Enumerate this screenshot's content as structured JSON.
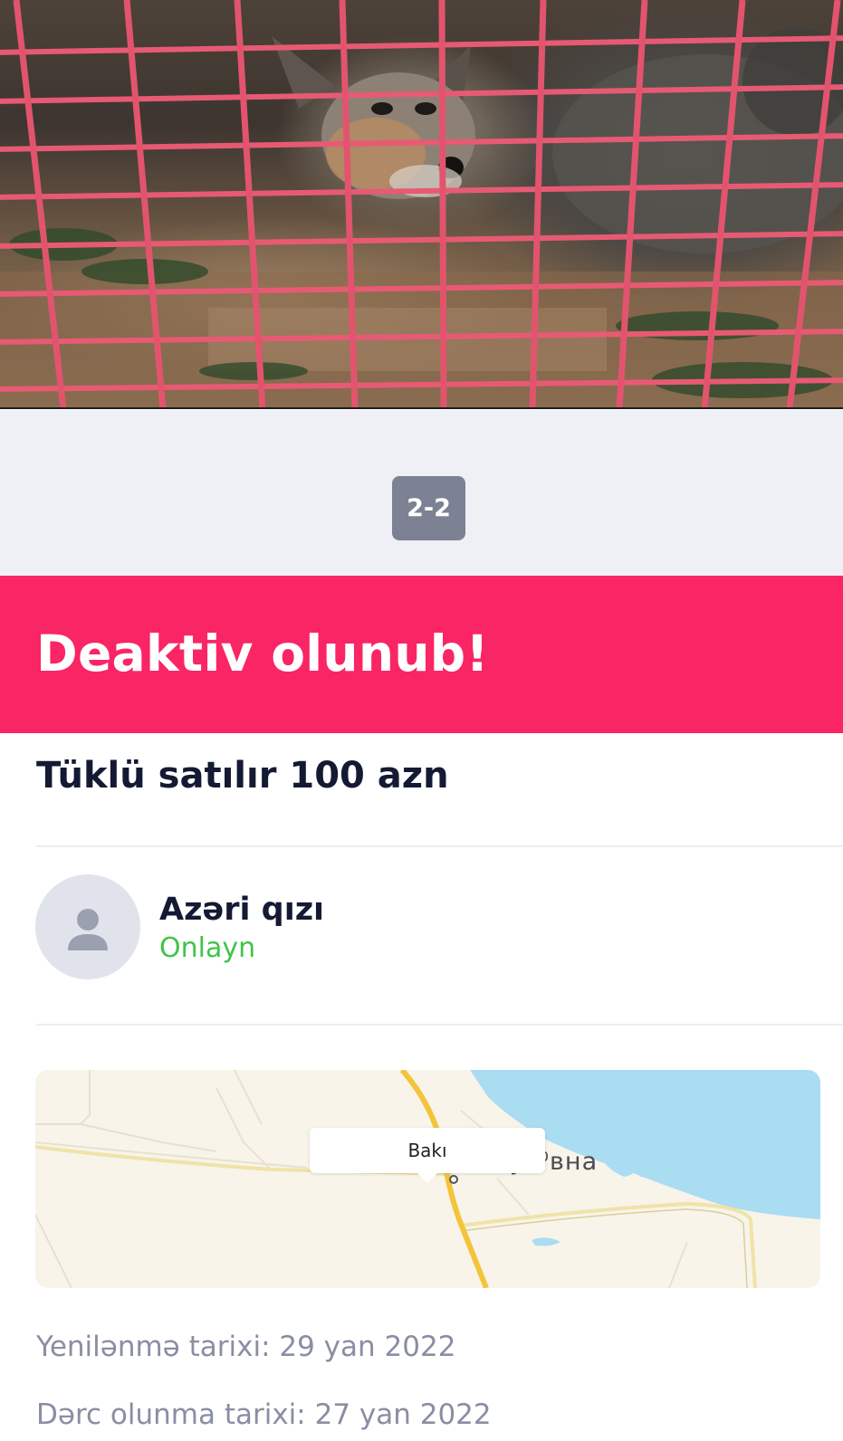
{
  "gallery": {
    "image_alt": "fox-in-cage-photo",
    "counter": "2-2"
  },
  "status_banner": {
    "text": "Deaktiv olunub!",
    "color": "#fa2565"
  },
  "listing": {
    "title": "Tüklü satılır 100 azn"
  },
  "seller": {
    "name": "Azəri qızı",
    "status": "Onlayn",
    "status_color": "#41c447",
    "avatar_icon": "user-silhouette-icon"
  },
  "map": {
    "callout_label": "Bakı",
    "place_label": "ᵦуз⁰вна"
  },
  "dates": {
    "updated": "Yenilənmə tarixi: 29 yan 2022",
    "published": "Dərc olunma tarixi: 27 yan 2022"
  }
}
